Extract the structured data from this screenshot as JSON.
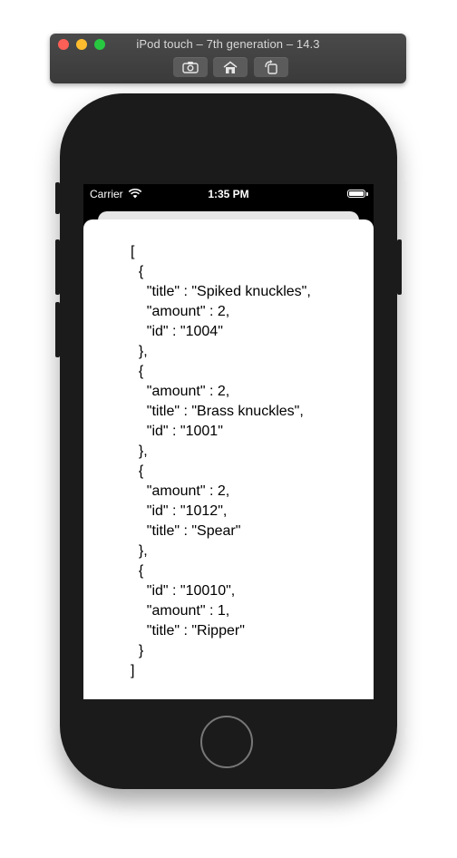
{
  "window": {
    "title": "iPod touch – 7th generation – 14.3",
    "toolbar": {
      "screenshot_icon": "camera-screenshot-icon",
      "home_icon": "home-icon",
      "rotate_icon": "rotate-icon"
    }
  },
  "status_bar": {
    "carrier": "Carrier",
    "time": "1:35 PM"
  },
  "content": {
    "json_text": "[\n  {\n    \"title\" : \"Spiked knuckles\",\n    \"amount\" : 2,\n    \"id\" : \"1004\"\n  },\n  {\n    \"amount\" : 2,\n    \"title\" : \"Brass knuckles\",\n    \"id\" : \"1001\"\n  },\n  {\n    \"amount\" : 2,\n    \"id\" : \"1012\",\n    \"title\" : \"Spear\"\n  },\n  {\n    \"id\" : \"10010\",\n    \"amount\" : 1,\n    \"title\" : \"Ripper\"\n  }\n]"
  },
  "colors": {
    "close": "#fe5f57",
    "minimize": "#febc2e",
    "zoom": "#28c840",
    "device": "#1b1b1b"
  }
}
